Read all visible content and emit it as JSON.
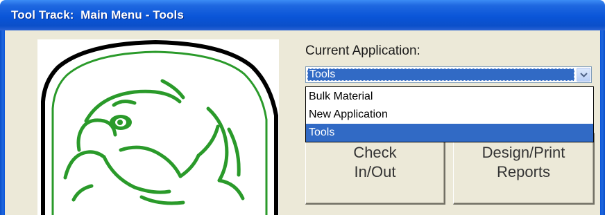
{
  "window": {
    "title": "Tool Track:  Main Menu - Tools"
  },
  "logo": {
    "icon": "eagle-head-logo",
    "colors": {
      "ring_outer": "#000000",
      "ring_inner": "#2a9a2a",
      "eagle": "#2a9a2a"
    }
  },
  "application": {
    "label": "Current Application:",
    "selected": "Tools",
    "options": [
      "Bulk Material",
      "New Application",
      "Tools"
    ],
    "highlighted_option": "Tools"
  },
  "buttons": {
    "check": "Check\nIn/Out",
    "reports": "Design/Print\nReports"
  },
  "colors": {
    "titlebar": "#0a55d8",
    "client_bg": "#ece9d8",
    "selection": "#316ac5"
  }
}
